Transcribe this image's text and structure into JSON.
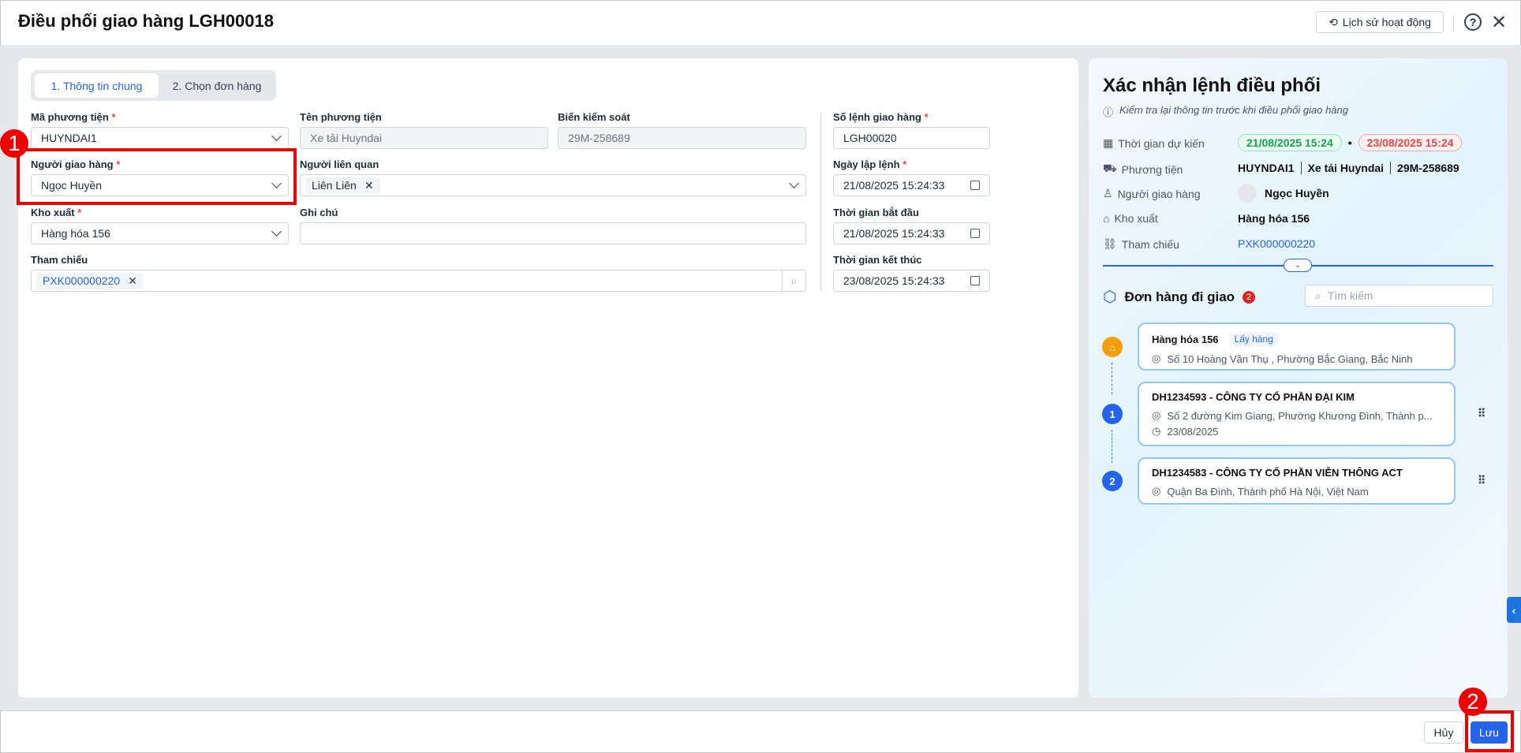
{
  "header": {
    "title": "Điều phối giao hàng LGH00018",
    "history_label": "Lịch sử hoạt động",
    "help": "?",
    "close": "✕"
  },
  "tabs": [
    "1. Thông tin chung",
    "2. Chọn đơn hàng"
  ],
  "form": {
    "vehicle_code": {
      "label": "Mã phương tiện",
      "value": "HUYNDAI1"
    },
    "vehicle_name": {
      "label": "Tên phương tiện",
      "value": "Xe tải Huyndai"
    },
    "plate": {
      "label": "Biển kiểm soát",
      "value": "29M-258689"
    },
    "order_no": {
      "label": "Số lệnh giao hàng",
      "value": "LGH00020"
    },
    "shipper": {
      "label": "Người giao hàng",
      "value": "Ngọc Huyền"
    },
    "related": {
      "label": "Người liên quan",
      "tag": "Liên Liên"
    },
    "created": {
      "label": "Ngày lập lệnh",
      "value": "21/08/2025 15:24:33"
    },
    "warehouse": {
      "label": "Kho xuất",
      "value": "Hàng hóa 156"
    },
    "note": {
      "label": "Ghi chú",
      "value": ""
    },
    "start": {
      "label": "Thời gian bắt đầu",
      "value": "21/08/2025 15:24:33"
    },
    "reference": {
      "label": "Tham chiếu",
      "tag": "PXK000000220"
    },
    "end": {
      "label": "Thời gian kết thúc",
      "value": "23/08/2025 15:24:33"
    },
    "required_mark": "*"
  },
  "panel": {
    "title": "Xác nhận lệnh điều phối",
    "subtitle": "Kiểm tra lại thông tin trước khi điều phối giao hàng",
    "rows": {
      "time": "Thời gian dự kiến",
      "vehicle": "Phương tiện",
      "shipper": "Người giao hàng",
      "warehouse": "Kho xuất",
      "reference": "Tham chiếu"
    },
    "time_start": "21/08/2025 15:24",
    "time_end": "23/08/2025 15:24",
    "vehicle_code": "HUYNDAI1",
    "vehicle_name": "Xe tải Huyndai",
    "plate": "29M-258689",
    "shipper": "Ngọc Huyền",
    "warehouse": "Hàng hóa 156",
    "reference": "PXK000000220",
    "orders_title": "Đơn hàng đi giao",
    "orders_count": "2",
    "search_placeholder": "Tìm kiếm",
    "pickup": {
      "name": "Hàng hóa 156",
      "tag": "Lấy hàng",
      "address": "Số 10 Hoàng Văn Thụ , Phường Bắc Giang, Bắc Ninh"
    },
    "orders": [
      {
        "index": "1",
        "title": "DH1234593 - CÔNG TY CỔ PHẦN ĐẠI KIM",
        "address": "Số 2 đường Kim Giang, Phường Khương Đình, Thành p...",
        "date": "23/08/2025"
      },
      {
        "index": "2",
        "title": "DH1234583 - CÔNG TY CỔ PHẦN VIỄN THÔNG ACT",
        "address": "Quận Ba Đình, Thành phố Hà Nội, Việt Nam"
      }
    ]
  },
  "footer": {
    "cancel": "Hủy",
    "save": "Lưu"
  },
  "annotations": {
    "one": "1",
    "two": "2"
  },
  "colors": {
    "primary": "#2563eb",
    "annotation": "#ee0000",
    "orange": "#f59e0b"
  }
}
